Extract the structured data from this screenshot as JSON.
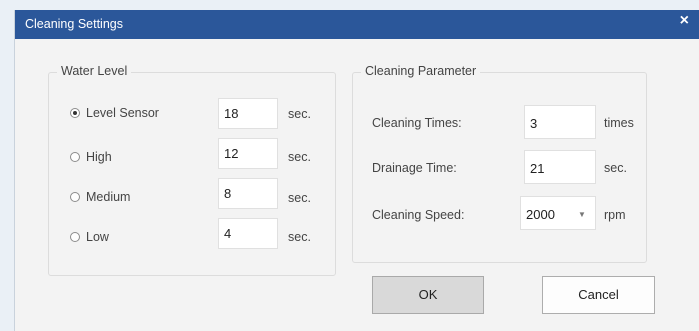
{
  "dialog": {
    "title": "Cleaning Settings",
    "close_icon": "×"
  },
  "water_level": {
    "legend": "Water Level",
    "items": [
      {
        "label": "Level Sensor",
        "value": "18",
        "unit": "sec.",
        "checked": true
      },
      {
        "label": "High",
        "value": "12",
        "unit": "sec.",
        "checked": false
      },
      {
        "label": "Medium",
        "value": "8",
        "unit": "sec.",
        "checked": false
      },
      {
        "label": "Low",
        "value": "4",
        "unit": "sec.",
        "checked": false
      }
    ]
  },
  "cleaning_parameter": {
    "legend": "Cleaning Parameter",
    "cleaning_times": {
      "label": "Cleaning Times:",
      "value": "3",
      "unit": "times"
    },
    "drainage_time": {
      "label": "Drainage Time:",
      "value": "21",
      "unit": "sec."
    },
    "cleaning_speed": {
      "label": "Cleaning Speed:",
      "value": "2000",
      "unit": "rpm",
      "arrow": "▼"
    }
  },
  "buttons": {
    "ok": "OK",
    "cancel": "Cancel"
  },
  "colors": {
    "titlebar": "#2b579a",
    "background": "#eaf0f6",
    "dialog": "#f3f3f3"
  }
}
